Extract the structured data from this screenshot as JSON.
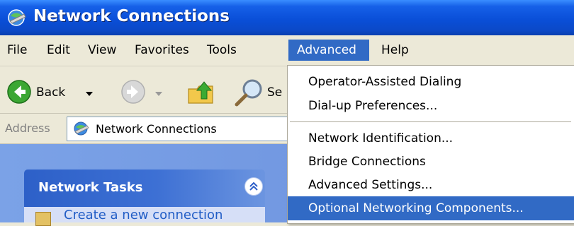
{
  "window": {
    "title": "Network Connections"
  },
  "menubar": {
    "items": [
      "File",
      "Edit",
      "View",
      "Favorites",
      "Tools",
      "Advanced",
      "Help"
    ],
    "active": "Advanced"
  },
  "toolbar": {
    "back_label": "Back",
    "search_label": "Se"
  },
  "address": {
    "label": "Address",
    "value": "Network Connections"
  },
  "taskpane": {
    "title": "Network Tasks",
    "first_item": "Create a new connection"
  },
  "dropdown": {
    "items": [
      "Operator-Assisted Dialing",
      "Dial-up Preferences...",
      "Network Identification...",
      "Bridge Connections",
      "Advanced Settings...",
      "Optional Networking Components..."
    ],
    "selected": "Optional Networking Components..."
  },
  "colors": {
    "titlebar": "#0A4FD8",
    "menu_highlight": "#316AC5",
    "taskpane_bg": "#7BA2E7"
  }
}
